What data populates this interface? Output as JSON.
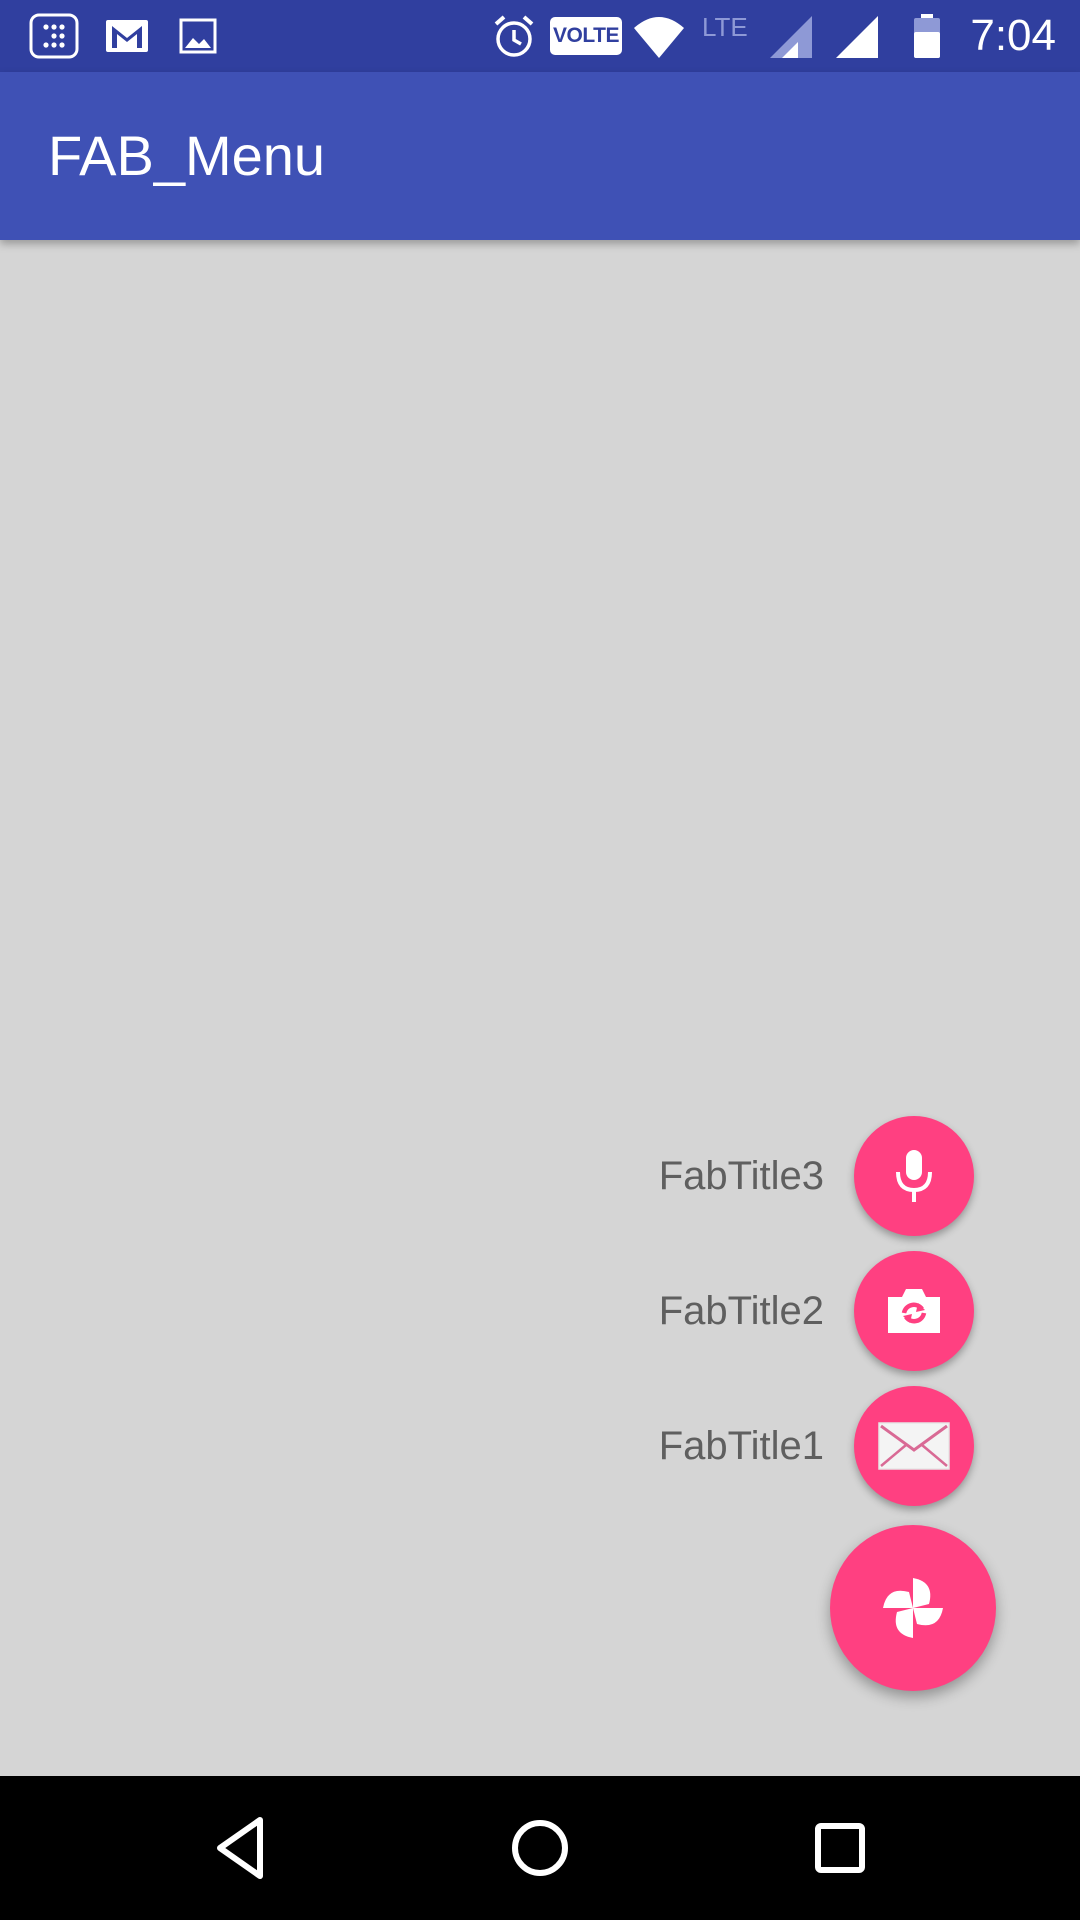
{
  "status_bar": {
    "time": "7:04",
    "volte_label": "VOLTE",
    "lte_label": "LTE",
    "icons": [
      "app-drawer-icon",
      "gmail-icon",
      "gallery-icon",
      "alarm-icon",
      "volte-icon",
      "wifi-icon",
      "signal-lte-icon",
      "signal-icon",
      "battery-icon"
    ]
  },
  "app_bar": {
    "title": "FAB_Menu"
  },
  "fab_menu": {
    "items": [
      {
        "label": "FabTitle3",
        "icon": "mic-icon"
      },
      {
        "label": "FabTitle2",
        "icon": "camera-switch-icon"
      },
      {
        "label": "FabTitle1",
        "icon": "mail-icon"
      }
    ],
    "main_icon": "pinwheel-icon",
    "accent_color": "#ff4081"
  },
  "colors": {
    "status_bar": "#303f9f",
    "app_bar": "#3f51b5",
    "background": "#d5d5d5",
    "label_text": "#5f5f5f"
  },
  "nav_bar": {
    "icons": [
      "back-icon",
      "home-icon",
      "recents-icon"
    ]
  }
}
